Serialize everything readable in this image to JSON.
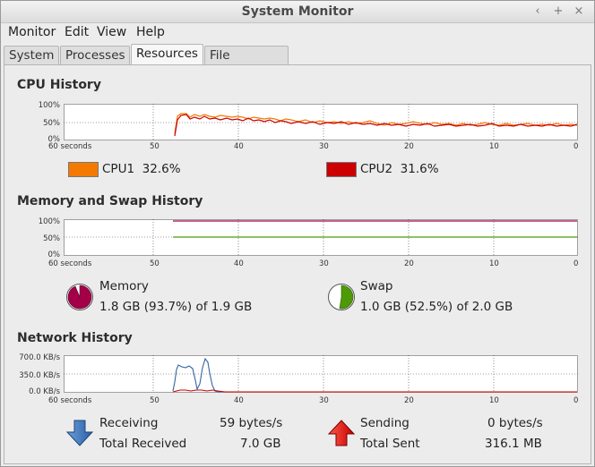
{
  "window": {
    "title": "System Monitor",
    "controls": [
      "‹",
      "+",
      "×"
    ]
  },
  "menu": [
    "Monitor",
    "Edit",
    "View",
    "Help"
  ],
  "tabs": [
    {
      "label": "System",
      "active": false
    },
    {
      "label": "Processes",
      "active": false
    },
    {
      "label": "Resources",
      "active": true
    },
    {
      "label": "File Systems",
      "active": false
    }
  ],
  "cpu": {
    "title": "CPU History",
    "y_ticks": [
      "100%",
      "50%",
      "0%"
    ],
    "x_ticks": [
      "60 seconds",
      "50",
      "40",
      "30",
      "20",
      "10",
      "0"
    ],
    "cpu1": {
      "label": "CPU1",
      "value": "32.6%",
      "color": "#f57900"
    },
    "cpu2": {
      "label": "CPU2",
      "value": "31.6%",
      "color": "#cc0000"
    }
  },
  "memory": {
    "title": "Memory and Swap History",
    "y_ticks": [
      "100%",
      "50%",
      "0%"
    ],
    "x_ticks": [
      "60 seconds",
      "50",
      "40",
      "30",
      "20",
      "10",
      "0"
    ],
    "mem": {
      "label": "Memory",
      "detail": "1.8 GB (93.7%) of 1.9 GB",
      "color": "#a40048",
      "fraction": 0.937
    },
    "swap": {
      "label": "Swap",
      "detail": "1.0 GB (52.5%) of 2.0 GB",
      "color": "#4e9a06",
      "fraction": 0.525
    }
  },
  "network": {
    "title": "Network History",
    "y_ticks": [
      "700.0 KB/s",
      "350.0 KB/s",
      "0.0 KB/s"
    ],
    "x_ticks": [
      "60 seconds",
      "50",
      "40",
      "30",
      "20",
      "10",
      "0"
    ],
    "receiving_label": "Receiving",
    "receiving_value": "59 bytes/s",
    "total_received_label": "Total Received",
    "total_received_value": "7.0 GB",
    "sending_label": "Sending",
    "sending_value": "0 bytes/s",
    "total_sent_label": "Total Sent",
    "total_sent_value": "316.1 MB",
    "recv_color": "#3465a4",
    "send_color": "#cc0000"
  }
}
